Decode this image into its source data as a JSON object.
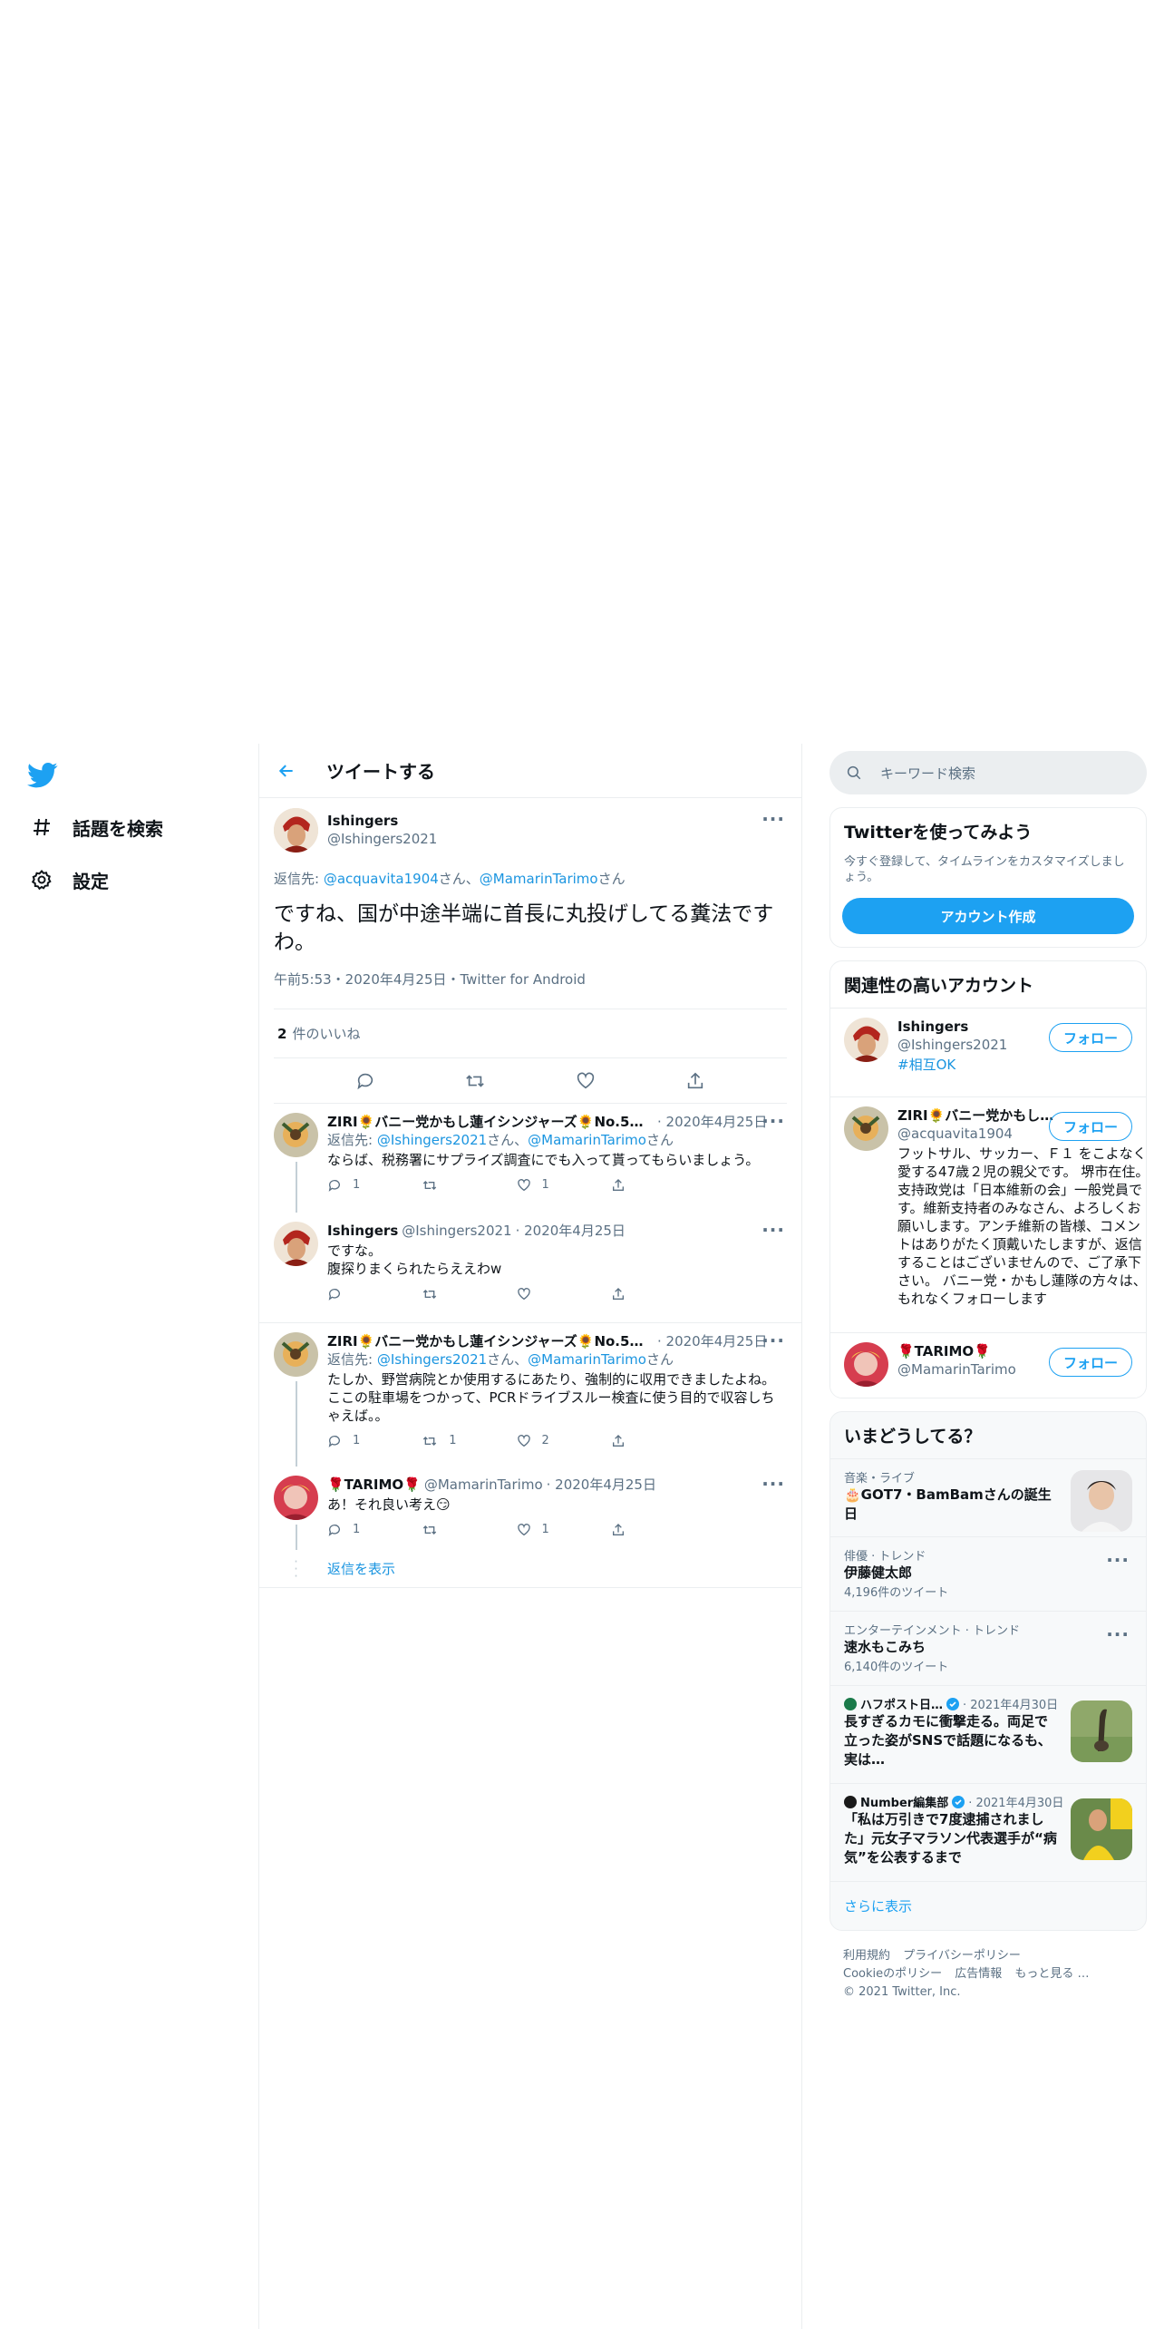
{
  "nav": {
    "explore_label": "話題を検索",
    "settings_label": "設定"
  },
  "header": {
    "title": "ツイートする"
  },
  "focus_tweet": {
    "name": "Ishingers",
    "handle": "@Ishingers2021",
    "reply_prefix": "返信先: ",
    "reply_user1": "@acquavita1904",
    "reply_mid": "さん、",
    "reply_user2": "@MamarinTarimo",
    "reply_suffix": "さん",
    "text": "ですね、国が中途半端に首長に丸投げしてる糞法ですわ。",
    "meta": "午前5:53・2020年4月25日・Twitter for Android",
    "likes_count": "2",
    "likes_label": "件のいいね"
  },
  "replies": [
    {
      "name": "ZIRI🌻バニー党かもし蓮イシンジャーズ🌻No.5だ…",
      "date": "· 2020年4月25日",
      "reply_prefix": "返信先: ",
      "reply_user1": "@Ishingers2021",
      "reply_mid": "さん、",
      "reply_user2": "@MamarinTarimo",
      "reply_suffix": "さん",
      "text": "ならば、税務署にサプライズ調査にでも入って貰ってもらいましょう。",
      "reply_count": "1",
      "retweet_count": "",
      "like_count": "1"
    },
    {
      "name": "Ishingers",
      "handle": "@Ishingers2021",
      "date": "· 2020年4月25日",
      "text1": "ですな。",
      "text2": "腹探りまくられたらええわw",
      "reply_count": "",
      "retweet_count": "",
      "like_count": ""
    },
    {
      "name": "ZIRI🌻バニー党かもし蓮イシンジャーズ🌻No.5だ…",
      "date": "· 2020年4月25日",
      "reply_prefix": "返信先: ",
      "reply_user1": "@Ishingers2021",
      "reply_mid": "さん、",
      "reply_user2": "@MamarinTarimo",
      "reply_suffix": "さん",
      "text": "たしか、野営病院とか使用するにあたり、強制的に収用できましたよね。ここの駐車場をつかって、PCRドライブスルー検査に使う目的で収容しちゃえば。。",
      "reply_count": "1",
      "retweet_count": "1",
      "like_count": "2"
    },
    {
      "name": "🌹TARIMO🌹",
      "handle": "@MamarinTarimo",
      "date": "· 2020年4月25日",
      "text": "あ！それ良い考え😏",
      "reply_count": "1",
      "retweet_count": "",
      "like_count": "1"
    }
  ],
  "show_replies_label": "返信を表示",
  "search": {
    "placeholder": "キーワード検索"
  },
  "signup": {
    "title": "Twitterを使ってみよう",
    "desc": "今すぐ登録して、タイムラインをカスタマイズしましょう。",
    "button": "アカウント作成"
  },
  "related": {
    "title": "関連性の高いアカウント",
    "follow_label": "フォロー",
    "accounts": [
      {
        "name": "Ishingers",
        "handle": "@Ishingers2021",
        "bio": "#相互OK"
      },
      {
        "name": "ZIRI🌻バニー党かもし…",
        "handle": "@acquavita1904",
        "bio": "フットサル、サッカー、Ｆ１ をこよなく愛する47歳２児の親父です。 堺市在住。支持政党は「日本維新の会」一般党員です。維新支持者のみなさん、よろしくお願いします。アンチ維新の皆様、コメントはありがたく頂戴いたしますが、返信することはございませんので、ご了承下さい。 バニー党・かもし蓮隊の方々は、もれなくフォローします"
      },
      {
        "name": "🌹TARIMO🌹",
        "handle": "@MamarinTarimo",
        "bio": ""
      }
    ]
  },
  "trends": {
    "title": "いまどうしてる？",
    "items": [
      {
        "context": "音楽・ライブ",
        "title": "🎂GOT7・BamBamさんの誕生日",
        "count": ""
      },
      {
        "context": "俳優 · トレンド",
        "title": "伊藤健太郎",
        "count": "4,196件のツイート"
      },
      {
        "context": "エンターテインメント · トレンド",
        "title": "速水もこみち",
        "count": "6,140件のツイート"
      }
    ],
    "news": [
      {
        "source": "ハフポスト日…",
        "date": "· 2021年4月30日",
        "title": "長すぎるカモに衝撃走る。両足で立った姿がSNSで話題になるも、実は…"
      },
      {
        "source": "Number編集部",
        "date": "· 2021年4月30日",
        "title": "「私は万引きで7度逮捕されました」元女子マラソン代表選手が“病気”を公表するまで"
      }
    ],
    "show_more": "さらに表示"
  },
  "footer": {
    "links": [
      "利用規約",
      "プライバシーポリシー",
      "Cookieのポリシー",
      "広告情報",
      "もっと見る …"
    ],
    "copyright": "© 2021 Twitter, Inc."
  },
  "colors": {
    "accent": "#1da1f2",
    "link": "#1b95e0",
    "muted": "#5b7083"
  }
}
